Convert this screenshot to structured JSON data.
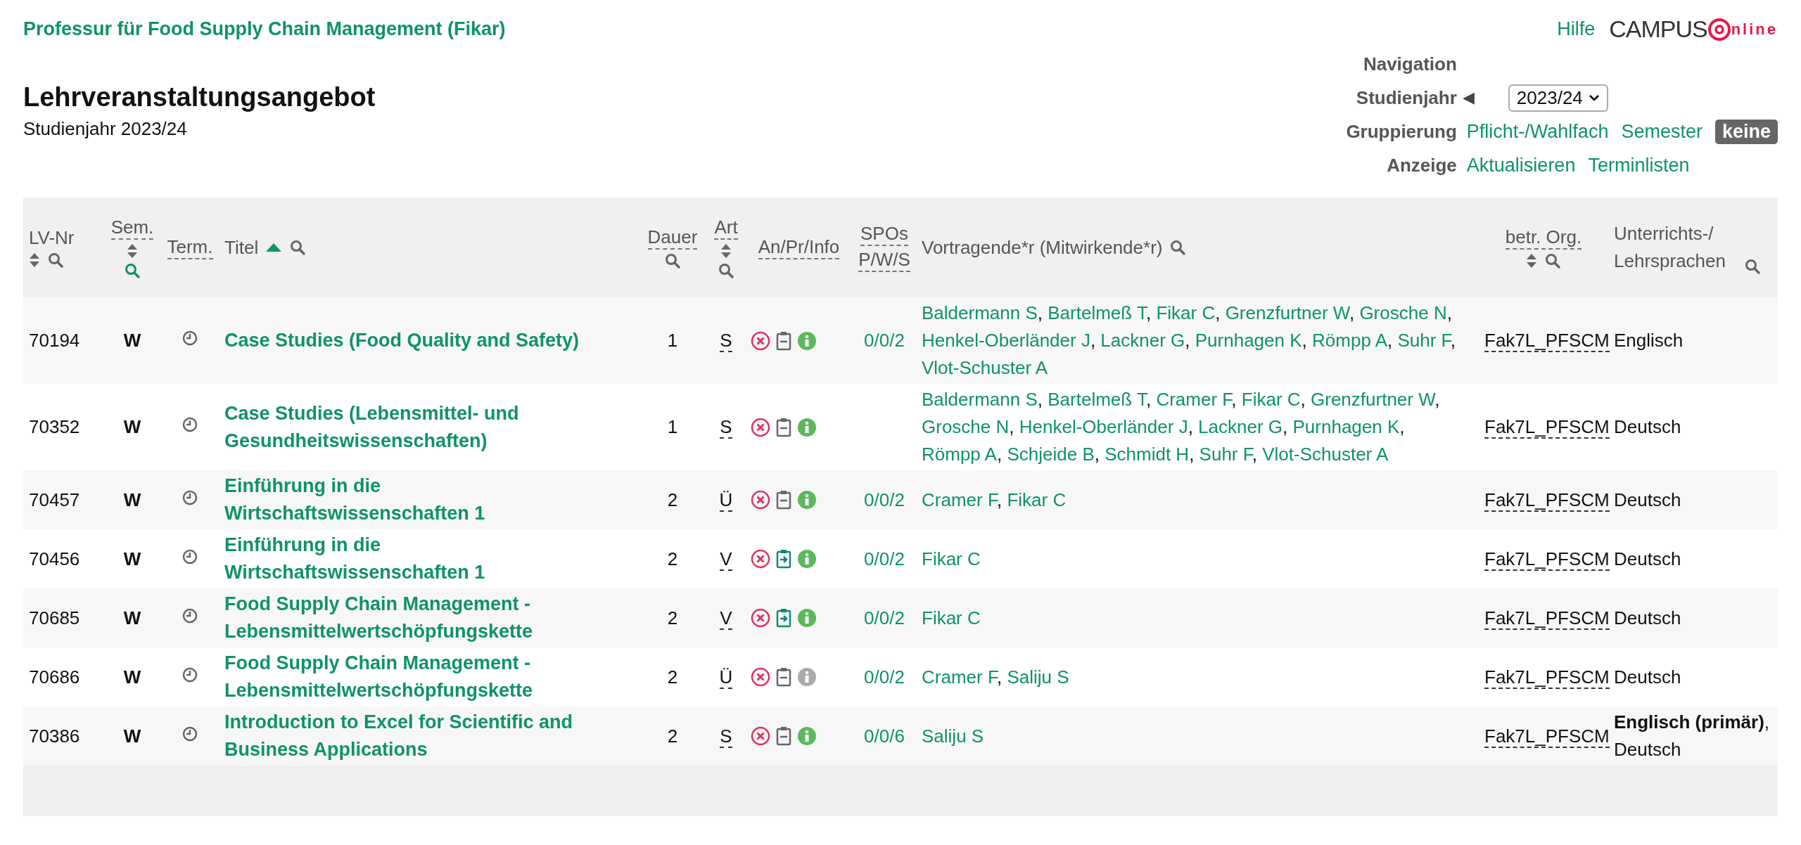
{
  "org_title": "Professur für Food Supply Chain Management (Fikar)",
  "help_link": "Hilfe",
  "logo": {
    "text": "CAMPUS",
    "suffix": "nline"
  },
  "page_title": "Lehrveranstaltungsangebot",
  "subtitle": "Studienjahr 2023/24",
  "navigation": {
    "heading": "Navigation",
    "year_label": "Studienjahr",
    "prev_arrow": "◀",
    "year_value": "2023/24",
    "grouping_label": "Gruppierung",
    "grouping_options": [
      {
        "label": "Pflicht-/Wahlfach",
        "selected": false
      },
      {
        "label": "Semester",
        "selected": false
      },
      {
        "label": "keine",
        "selected": true
      }
    ],
    "display_label": "Anzeige",
    "display_links": [
      "Aktualisieren",
      "Terminlisten"
    ]
  },
  "table": {
    "columns": [
      {
        "label": "LV-Nr",
        "dashed": false,
        "sortable": true,
        "sorted": false,
        "searchable": true,
        "filtered": false
      },
      {
        "label": "Sem.",
        "dashed": true,
        "sortable": true,
        "sorted": false,
        "searchable": true,
        "filtered": true
      },
      {
        "label": "Term.",
        "dashed": true,
        "sortable": false,
        "sorted": false,
        "searchable": false,
        "filtered": false
      },
      {
        "label": "Titel",
        "dashed": false,
        "sortable": false,
        "sorted": true,
        "searchable": true,
        "filtered": false
      },
      {
        "label": "Dauer",
        "dashed": true,
        "sortable": false,
        "sorted": false,
        "searchable": true,
        "filtered": false
      },
      {
        "label": "Art",
        "dashed": true,
        "sortable": true,
        "sorted": false,
        "searchable": true,
        "filtered": false
      },
      {
        "label": "An/Pr/Info",
        "dashed": true,
        "sortable": false,
        "sorted": false,
        "searchable": false,
        "filtered": false
      },
      {
        "label": "SPOs",
        "sublabel": "P/W/S",
        "dashed": true,
        "sortable": false,
        "sorted": false,
        "searchable": false,
        "filtered": false
      },
      {
        "label": "Vortragende*r (Mitwirkende*r)",
        "dashed": false,
        "sortable": false,
        "sorted": false,
        "searchable": true,
        "filtered": false
      },
      {
        "label": "betr. Org.",
        "dashed": true,
        "sortable": true,
        "sorted": false,
        "searchable": true,
        "filtered": false
      },
      {
        "label": "Unterrichts-/ Lehrsprachen",
        "dashed": false,
        "sortable": false,
        "sorted": false,
        "searchable": true,
        "filtered": false
      }
    ],
    "rows": [
      {
        "lv_nr": "70194",
        "sem": "W",
        "title": "Case Studies (Food Quality and Safety)",
        "dauer": "1",
        "art": "S",
        "registration_open": false,
        "info_available": true,
        "spos": "0/0/2",
        "lecturers": [
          {
            "name": "Baldermann S",
            "separator": ","
          },
          {
            "name": "Bartelmeß T",
            "separator": ","
          },
          {
            "name": "Fikar C",
            "separator": ","
          },
          {
            "name": "Grenzfurtner W",
            "separator": ","
          },
          {
            "name": "Grosche N",
            "separator": ","
          },
          {
            "name": "Henkel-Oberländer J",
            "separator": ","
          },
          {
            "name": "Lackner G",
            "separator": ","
          },
          {
            "name": "Purnhagen K",
            "separator": ","
          },
          {
            "name": "Römpp A",
            "separator": ","
          },
          {
            "name": "Suhr F",
            "separator": ","
          },
          {
            "name": "Vlot-Schuster A"
          }
        ],
        "org": "Fak7L_PFSCM",
        "languages": "Englisch"
      },
      {
        "lv_nr": "70352",
        "sem": "W",
        "title": "Case Studies (Lebensmittel- und Gesundheitswissenschaften)",
        "dauer": "1",
        "art": "S",
        "registration_open": false,
        "info_available": true,
        "lecturers": [
          {
            "name": "Baldermann S",
            "separator": ","
          },
          {
            "name": "Bartelmeß T",
            "separator": ","
          },
          {
            "name": "Cramer F",
            "separator": ","
          },
          {
            "name": "Fikar C",
            "separator": ","
          },
          {
            "name": "Grenzfurtner W",
            "separator": ","
          },
          {
            "name": "Grosche N",
            "separator": ","
          },
          {
            "name": "Henkel-Oberländer J",
            "separator": ","
          },
          {
            "name": "Lackner G",
            "separator": ","
          },
          {
            "name": "Purnhagen K",
            "separator": ","
          },
          {
            "name": "Römpp A",
            "separator": ","
          },
          {
            "name": "Schjeide B",
            "separator": ","
          },
          {
            "name": "Schmidt H",
            "separator": ","
          },
          {
            "name": "Suhr F",
            "separator": ","
          },
          {
            "name": "Vlot-Schuster A"
          }
        ],
        "org": "Fak7L_PFSCM",
        "languages": "Deutsch"
      },
      {
        "lv_nr": "70457",
        "sem": "W",
        "title": "Einführung in die Wirtschaftswissenschaften 1",
        "dauer": "2",
        "art": "Ü",
        "registration_open": false,
        "info_available": true,
        "spos": "0/0/2",
        "lecturers": [
          {
            "name": "Cramer F",
            "separator": ","
          },
          {
            "name": "Fikar C"
          }
        ],
        "org": "Fak7L_PFSCM",
        "languages": "Deutsch"
      },
      {
        "lv_nr": "70456",
        "sem": "W",
        "title": "Einführung in die Wirtschaftswissenschaften 1",
        "dauer": "2",
        "art": "V",
        "registration_open": true,
        "info_available": true,
        "spos": "0/0/2",
        "lecturers": [
          {
            "name": "Fikar C"
          }
        ],
        "org": "Fak7L_PFSCM",
        "languages": "Deutsch"
      },
      {
        "lv_nr": "70685",
        "sem": "W",
        "title": "Food Supply Chain Management - Lebensmittelwertschöpfungskette",
        "dauer": "2",
        "art": "V",
        "registration_open": true,
        "info_available": true,
        "spos": "0/0/2",
        "lecturers": [
          {
            "name": "Fikar C"
          }
        ],
        "org": "Fak7L_PFSCM",
        "languages": "Deutsch"
      },
      {
        "lv_nr": "70686",
        "sem": "W",
        "title": "Food Supply Chain Management - Lebensmittelwertschöpfungskette",
        "dauer": "2",
        "art": "Ü",
        "registration_open": false,
        "info_available": false,
        "spos": "0/0/2",
        "lecturers": [
          {
            "name": "Cramer F",
            "separator": ","
          },
          {
            "name": "Saliju S"
          }
        ],
        "org": "Fak7L_PFSCM",
        "languages": "Deutsch"
      },
      {
        "lv_nr": "70386",
        "sem": "W",
        "title": "Introduction to Excel for Scientific and Business Applications",
        "dauer": "2",
        "art": "S",
        "registration_open": false,
        "info_available": true,
        "spos": "0/0/6",
        "lecturers": [
          {
            "name": "Saliju S"
          }
        ],
        "org": "Fak7L_PFSCM",
        "languages": "**Englisch (primär)**, Deutsch"
      }
    ]
  }
}
